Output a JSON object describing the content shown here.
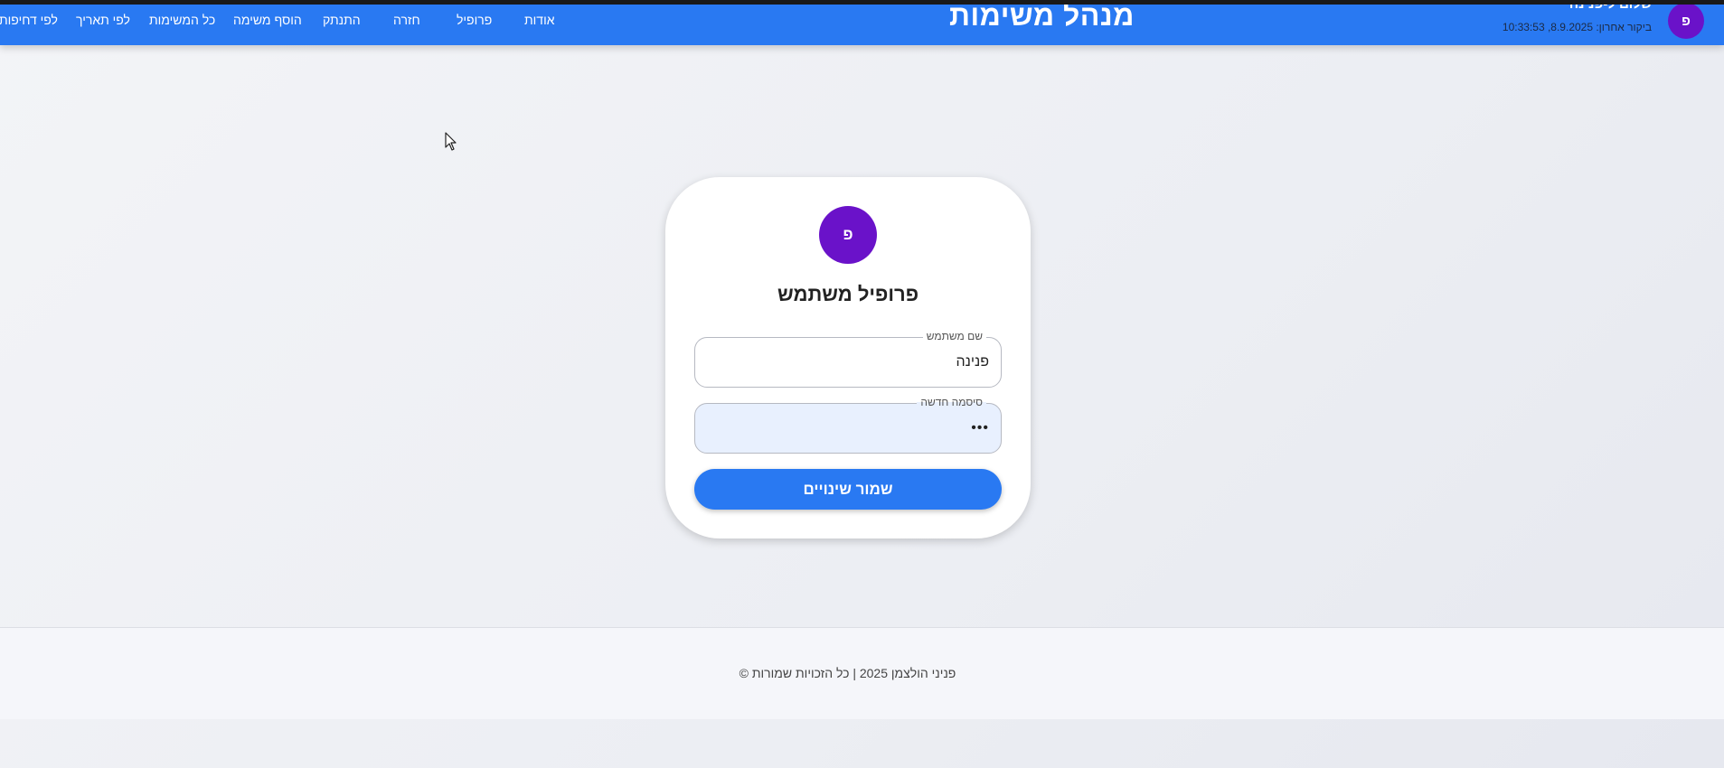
{
  "header": {
    "brand": "מנהל משימות",
    "greeting": "שלום ל-פנינה",
    "last_visit": "ביקור אחרון: 8.9.2025, 10:33:53",
    "avatar_letter": "פ",
    "nav_links": {
      "about": "אודות",
      "profile": "פרופיל",
      "back": "חזרה",
      "logout": "התנתק",
      "add_task": "הוסף משימה",
      "all_tasks": "כל המשימות",
      "by_date": "לפי תאריך",
      "by_urgency": "לפי דחיפות"
    }
  },
  "profile_card": {
    "avatar_letter": "פ",
    "title": "פרופיל משתמש",
    "username": {
      "label": "שם משתמש",
      "value": "פנינה"
    },
    "new_password": {
      "label": "סיסמה חדשה",
      "value": "•••"
    },
    "save_label": "שמור שינויים"
  },
  "footer": {
    "text": "פניני הולצמן 2025 | כל הזכויות שמורות ©"
  },
  "colors": {
    "primary": "#2979f2",
    "avatar": "#6a12c9",
    "password_field_bg": "#e8f0fe"
  }
}
